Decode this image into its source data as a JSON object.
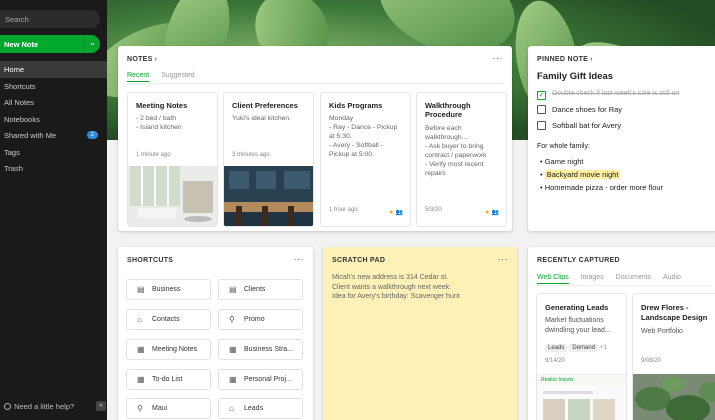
{
  "sidebar": {
    "search_placeholder": "Search",
    "new_note": "New Note",
    "nav": [
      {
        "label": "Home"
      },
      {
        "label": "Shortcuts"
      },
      {
        "label": "All Notes"
      },
      {
        "label": "Notebooks"
      },
      {
        "label": "Shared with Me",
        "badge": "2"
      },
      {
        "label": "Tags"
      },
      {
        "label": "Trash"
      }
    ],
    "help": "Need a little help?",
    "collapse": "«"
  },
  "notes": {
    "title": "NOTES",
    "tabs": [
      "Recent",
      "Suggested"
    ],
    "cards": [
      {
        "title": "Meeting Notes",
        "body": "- 2 bed / bath\n- Island kitchen",
        "date": "1 minute ago"
      },
      {
        "title": "Client Preferences",
        "body": "Yuki's ideal kitchen.",
        "date": "3 minutes ago"
      },
      {
        "title": "Kids Programs",
        "body": "Monday\n- Ray - Dance - Pickup at 5:30.\n- Avery - Softball - Pickup at 5:00.",
        "date": "1 hour ago"
      },
      {
        "title": "Walkthrough Procedure",
        "body": "Before each walkthrough...\n- Ask buyer to bring contract / paperwork\n- Verify most recent repairs",
        "date": "5/3/20"
      }
    ]
  },
  "pinned": {
    "title": "PINNED NOTE",
    "note_title": "Family Gift Ideas",
    "checklist": [
      {
        "text": "Double check if last week's sale is still on",
        "done": true
      },
      {
        "text": "Dance shoes for Ray",
        "done": false
      },
      {
        "text": "Softball bat for Avery",
        "done": false
      }
    ],
    "family_label": "For whole family:",
    "bullets": [
      "Game night",
      "Backyard movie night",
      "Homemade pizza - order more flour"
    ]
  },
  "shortcuts": {
    "title": "SHORTCUTS",
    "items": [
      "Business",
      "Clients",
      "Contacts",
      "Promo",
      "Meeting Notes",
      "Business Stra...",
      "To-do List",
      "Personal Proj...",
      "Maui",
      "Leads"
    ]
  },
  "scratch": {
    "title": "SCRATCH PAD",
    "lines": [
      "Micah's new address is 314 Cedar st.",
      "Client wants a walkthrough next week.",
      "Idea for Avery's birthday: Scavenger hunt"
    ]
  },
  "recent": {
    "title": "RECENTLY CAPTURED",
    "tabs": [
      "Web Clips",
      "Images",
      "Documents",
      "Audio"
    ],
    "cards": [
      {
        "title": "Generating Leads",
        "body": "Market fluctuations dwindling your lead...",
        "tags": [
          "Leads",
          "Demand",
          "+1"
        ],
        "date": "9/14/20",
        "clip_header": "Realtor Insurts"
      },
      {
        "title": "Drew Flores - Landscape Design",
        "body": "Web Portfolio",
        "date": "9/08/20"
      }
    ]
  },
  "colors": {
    "accent": "#00a82d",
    "scratch_bg": "#fdf1b8",
    "highlight": "#ffef9e"
  },
  "more_label": "···"
}
